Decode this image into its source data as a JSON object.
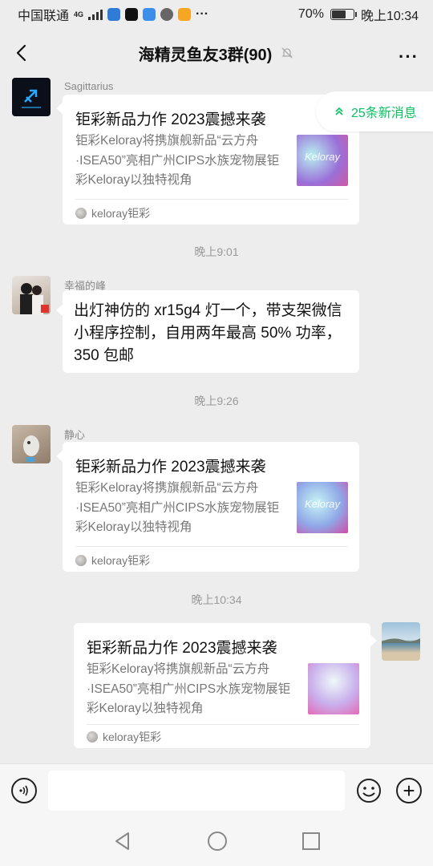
{
  "status": {
    "carrier": "中国联通",
    "network": "4G",
    "battery": "70%",
    "battery_level": 0.7,
    "time": "晚上10:34"
  },
  "nav": {
    "title": "海精灵鱼友3群(90)"
  },
  "new_messages": "25条新消息",
  "messages": [
    {
      "sender": "Sagittarius",
      "title": "钜彩新品力作 2023震撼来袭",
      "desc": "钜彩Keloray将携旗舰新品“云方舟·ISEA50”亮相广州CIPS水族宠物展钜彩Keloray以独特视角",
      "source": "keloray钜彩",
      "thumb_text": "Keloray"
    },
    {
      "time": "晚上9:01",
      "sender": "幸福的峰",
      "text": "出灯神仿的 xr15g4 灯一个，带支架微信小程序控制，自用两年最高 50% 功率，350 包邮"
    },
    {
      "time": "晚上9:26",
      "sender": "静心",
      "title": "钜彩新品力作 2023震撼来袭",
      "desc": "钜彩Keloray将携旗舰新品“云方舟·ISEA50”亮相广州CIPS水族宠物展钜彩Keloray以独特视角",
      "source": "keloray钜彩",
      "thumb_text": "Keloray"
    },
    {
      "time": "晚上10:34",
      "title": "钜彩新品力作 2023震撼来袭",
      "desc": "钜彩Keloray将携旗舰新品“云方舟·ISEA50”亮相广州CIPS水族宠物展钜彩Keloray以独特视角",
      "source": "keloray钜彩"
    }
  ]
}
